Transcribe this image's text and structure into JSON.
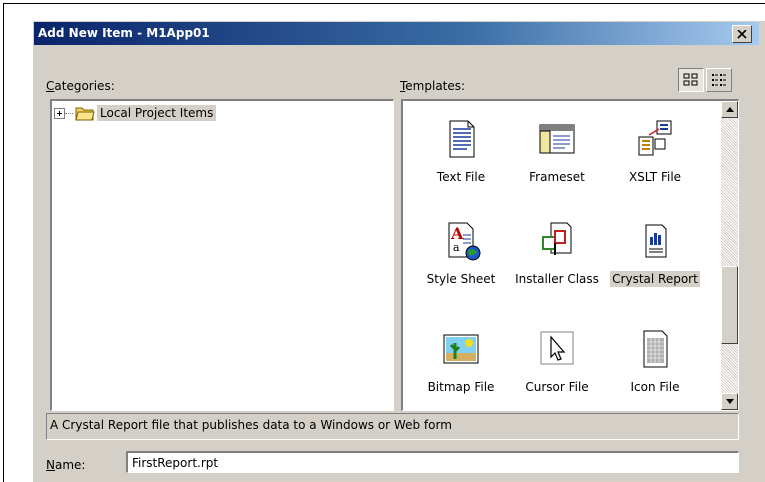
{
  "dialog": {
    "title": "Add New Item - M1App01",
    "close_label": "×"
  },
  "categories": {
    "label": "Categories:",
    "items": [
      {
        "label": "Local Project Items",
        "expander": "+"
      }
    ]
  },
  "templates": {
    "label": "Templates:",
    "view_modes": [
      "large-icons",
      "small-icons"
    ],
    "selected_view": "large-icons",
    "items": [
      {
        "label": "Text File",
        "icon": "text-file-icon"
      },
      {
        "label": "Frameset",
        "icon": "frameset-icon"
      },
      {
        "label": "XSLT File",
        "icon": "xslt-file-icon"
      },
      {
        "label": "Style Sheet",
        "icon": "style-sheet-icon"
      },
      {
        "label": "Installer Class",
        "icon": "installer-class-icon"
      },
      {
        "label": "Crystal Report",
        "icon": "crystal-report-icon",
        "selected": true
      },
      {
        "label": "Bitmap File",
        "icon": "bitmap-file-icon"
      },
      {
        "label": "Cursor File",
        "icon": "cursor-file-icon"
      },
      {
        "label": "Icon File",
        "icon": "icon-file-icon"
      }
    ]
  },
  "description": "A Crystal Report file that publishes data to a Windows or Web form",
  "name_field": {
    "label": "Name:",
    "value": "FirstReport.rpt"
  },
  "colors": {
    "title_start": "#0a246a",
    "title_end": "#a6caf0",
    "face": "#d4d0c8"
  }
}
